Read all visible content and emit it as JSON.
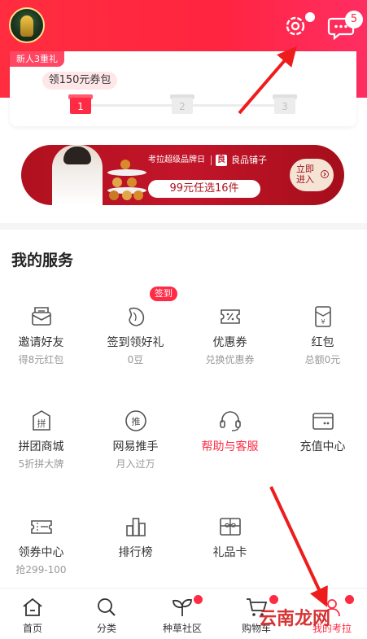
{
  "header": {
    "message_count": "5",
    "icons": [
      "avatar",
      "settings-icon",
      "message-icon"
    ]
  },
  "newcomer": {
    "tag": "新人3重礼",
    "coupon_pack": "领150元券包",
    "steps": [
      "1",
      "2",
      "3"
    ],
    "active_step": 1
  },
  "banner": {
    "top_text": "考拉超级品牌日",
    "brand_logo": "良",
    "brand_name": "良品铺子",
    "promo": "99元任选16件",
    "enter_line1": "立即",
    "enter_line2": "进入"
  },
  "services": {
    "title": "我的服务",
    "sign_badge": "签到",
    "items": [
      {
        "label": "邀请好友",
        "sub": "得8元红包",
        "icon": "invite-envelope-icon"
      },
      {
        "label": "签到领好礼",
        "sub": "0豆",
        "icon": "bean-icon"
      },
      {
        "label": "优惠券",
        "sub": "兑换优惠券",
        "icon": "coupon-icon"
      },
      {
        "label": "红包",
        "sub": "总额0元",
        "icon": "red-envelope-icon"
      },
      {
        "label": "拼团商城",
        "sub": "5折拼大牌",
        "icon": "group-buy-icon"
      },
      {
        "label": "网易推手",
        "sub": "月入过万",
        "icon": "promoter-icon"
      },
      {
        "label": "帮助与客服",
        "sub": "",
        "icon": "headset-icon"
      },
      {
        "label": "充值中心",
        "sub": "",
        "icon": "wallet-icon"
      },
      {
        "label": "领券中心",
        "sub": "抢299-100",
        "icon": "ticket-icon"
      },
      {
        "label": "排行榜",
        "sub": "",
        "icon": "ranking-icon"
      },
      {
        "label": "礼品卡",
        "sub": "",
        "icon": "gift-card-icon"
      }
    ]
  },
  "bottom_nav": {
    "items": [
      {
        "label": "首页",
        "icon": "home-icon"
      },
      {
        "label": "分类",
        "icon": "search-icon"
      },
      {
        "label": "种草社区",
        "icon": "sprout-icon"
      },
      {
        "label": "购物车",
        "icon": "cart-icon"
      },
      {
        "label": "我的考拉",
        "icon": "profile-icon"
      }
    ],
    "active": "我的考拉"
  },
  "watermark": "云南龙网",
  "colors": {
    "brand_red": "#ff2b44",
    "banner_red": "#b0111e",
    "gray_text": "#999999"
  }
}
